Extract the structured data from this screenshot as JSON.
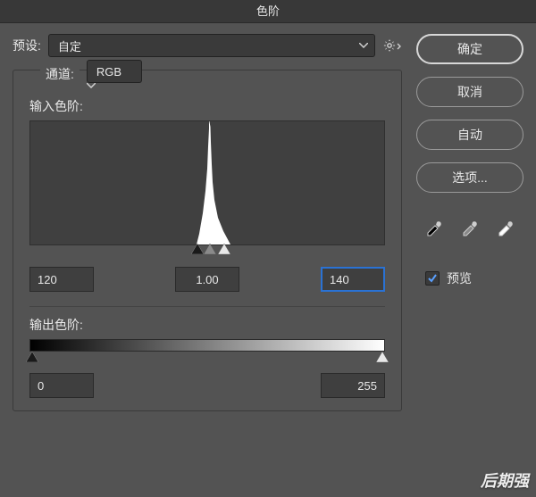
{
  "title": "色阶",
  "preset": {
    "label": "预设:",
    "value": "自定"
  },
  "channel": {
    "label": "通道:",
    "value": "RGB"
  },
  "input_levels": {
    "label": "输入色阶:",
    "black": "120",
    "gamma": "1.00",
    "white": "140"
  },
  "output_levels": {
    "label": "输出色阶:",
    "black": "0",
    "white": "255"
  },
  "buttons": {
    "ok": "确定",
    "cancel": "取消",
    "auto": "自动",
    "options": "选项..."
  },
  "preview": {
    "label": "预览",
    "checked": true
  },
  "eyedroppers": {
    "black": "black-point-eyedropper",
    "gray": "gray-point-eyedropper",
    "white": "white-point-eyedropper"
  },
  "watermark": "后期强"
}
